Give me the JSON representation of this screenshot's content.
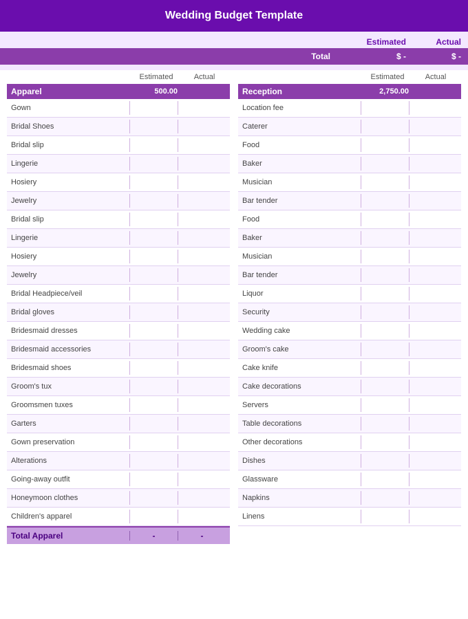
{
  "header": {
    "title": "Wedding Budget Template"
  },
  "totals": {
    "estimated_label": "Estimated",
    "actual_label": "Actual",
    "total_label": "Total",
    "estimated_value": "$    -",
    "actual_value": "$    -"
  },
  "apparel": {
    "category": "Apparel",
    "estimated": "500.00",
    "items": [
      "Gown",
      "Bridal Shoes",
      "Bridal slip",
      "Lingerie",
      "Hosiery",
      "Jewelry",
      "Bridal slip",
      "Lingerie",
      "Hosiery",
      "Jewelry",
      "Bridal Headpiece/veil",
      "Bridal gloves",
      "Bridesmaid dresses",
      "Bridesmaid accessories",
      "Bridesmaid shoes",
      "Groom's tux",
      "Groomsmen tuxes",
      "Garters",
      "Gown preservation",
      "Alterations",
      "Going-away outfit",
      "Honeymoon clothes",
      "Children's apparel"
    ],
    "total_label": "Total Apparel",
    "total_est": "-",
    "total_act": "-"
  },
  "reception": {
    "category": "Reception",
    "estimated": "2,750.00",
    "items": [
      "Location fee",
      "Caterer",
      "Food",
      "Baker",
      "Musician",
      "Bar tender",
      "Food",
      "Baker",
      "Musician",
      "Bar tender",
      "Liquor",
      "Security",
      "Wedding cake",
      "Groom's cake",
      "Cake knife",
      "Cake decorations",
      "Servers",
      "Table decorations",
      "Other decorations",
      "Dishes",
      "Glassware",
      "Napkins",
      "Linens"
    ]
  }
}
